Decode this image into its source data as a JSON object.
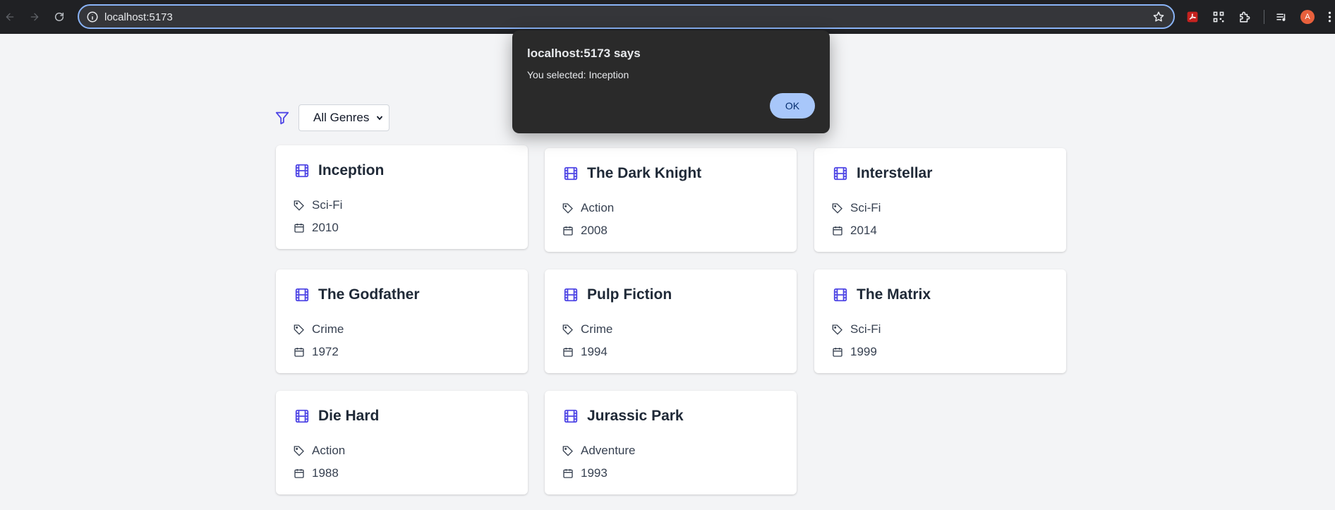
{
  "browser": {
    "url": "localhost:5173",
    "profile_initial": "A",
    "icons": [
      "back-icon",
      "forward-icon",
      "reload-icon",
      "info-icon",
      "star-icon",
      "pdf-extension-icon",
      "qr-extension-icon",
      "extensions-puzzle-icon",
      "media-control-icon",
      "profile-avatar",
      "menu-icon"
    ]
  },
  "filter": {
    "icon": "filter-icon",
    "selected": "All Genres"
  },
  "movies": [
    {
      "title": "Inception",
      "genre": "Sci-Fi",
      "year": "2010"
    },
    {
      "title": "The Dark Knight",
      "genre": "Action",
      "year": "2008"
    },
    {
      "title": "Interstellar",
      "genre": "Sci-Fi",
      "year": "2014"
    },
    {
      "title": "The Godfather",
      "genre": "Crime",
      "year": "1972"
    },
    {
      "title": "Pulp Fiction",
      "genre": "Crime",
      "year": "1994"
    },
    {
      "title": "The Matrix",
      "genre": "Sci-Fi",
      "year": "1999"
    },
    {
      "title": "Die Hard",
      "genre": "Action",
      "year": "1988"
    },
    {
      "title": "Jurassic Park",
      "genre": "Adventure",
      "year": "1993"
    }
  ],
  "alert": {
    "title": "localhost:5173 says",
    "message": "You selected: Inception",
    "ok_label": "OK"
  },
  "colors": {
    "accent": "#4f46e5",
    "chrome_bg": "#202124",
    "alert_bg": "#2a2a2a",
    "ok_button": "#a8c7fa",
    "page_bg": "#f3f4f6"
  }
}
